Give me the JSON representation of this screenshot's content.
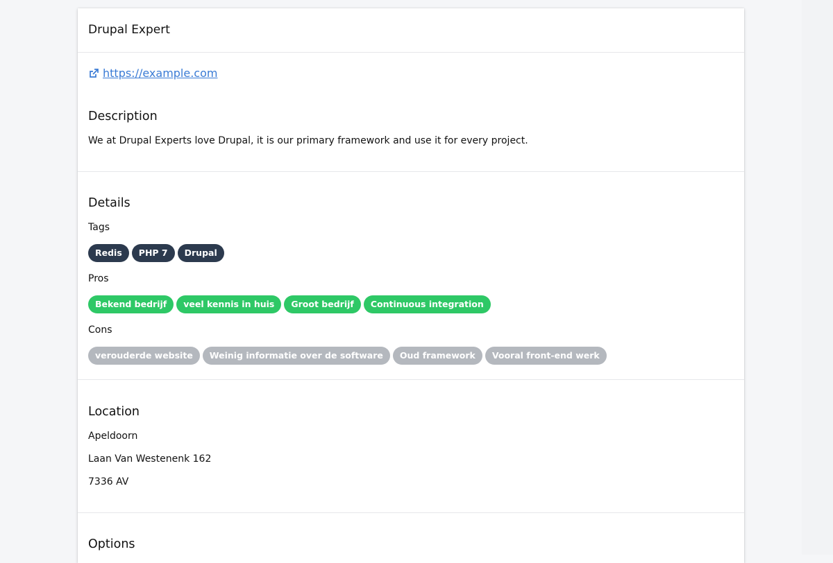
{
  "header": {
    "title": "Drupal Expert"
  },
  "website": {
    "url_label": "https://example.com"
  },
  "description": {
    "heading": "Description",
    "text": "We at Drupal Experts love Drupal, it is our primary framework and use it for every project."
  },
  "details": {
    "heading": "Details",
    "tags_label": "Tags",
    "tags": [
      "Redis",
      "PHP 7",
      "Drupal"
    ],
    "pros_label": "Pros",
    "pros": [
      "Bekend bedrijf",
      "veel kennis in huis",
      "Groot bedrijf",
      "Continuous integration"
    ],
    "cons_label": "Cons",
    "cons": [
      "verouderde website",
      "Weinig informatie over de software",
      "Oud framework",
      "Vooral front-end werk"
    ]
  },
  "location": {
    "heading": "Location",
    "city": "Apeldoorn",
    "street": "Laan Van Westenenk 162",
    "postcode": "7336 AV"
  },
  "options": {
    "heading": "Options"
  },
  "colors": {
    "link": "#3a7bd5",
    "tag_badge": "#2c3a4e",
    "pro_badge": "#2ec866",
    "con_badge": "#b4b8be"
  }
}
